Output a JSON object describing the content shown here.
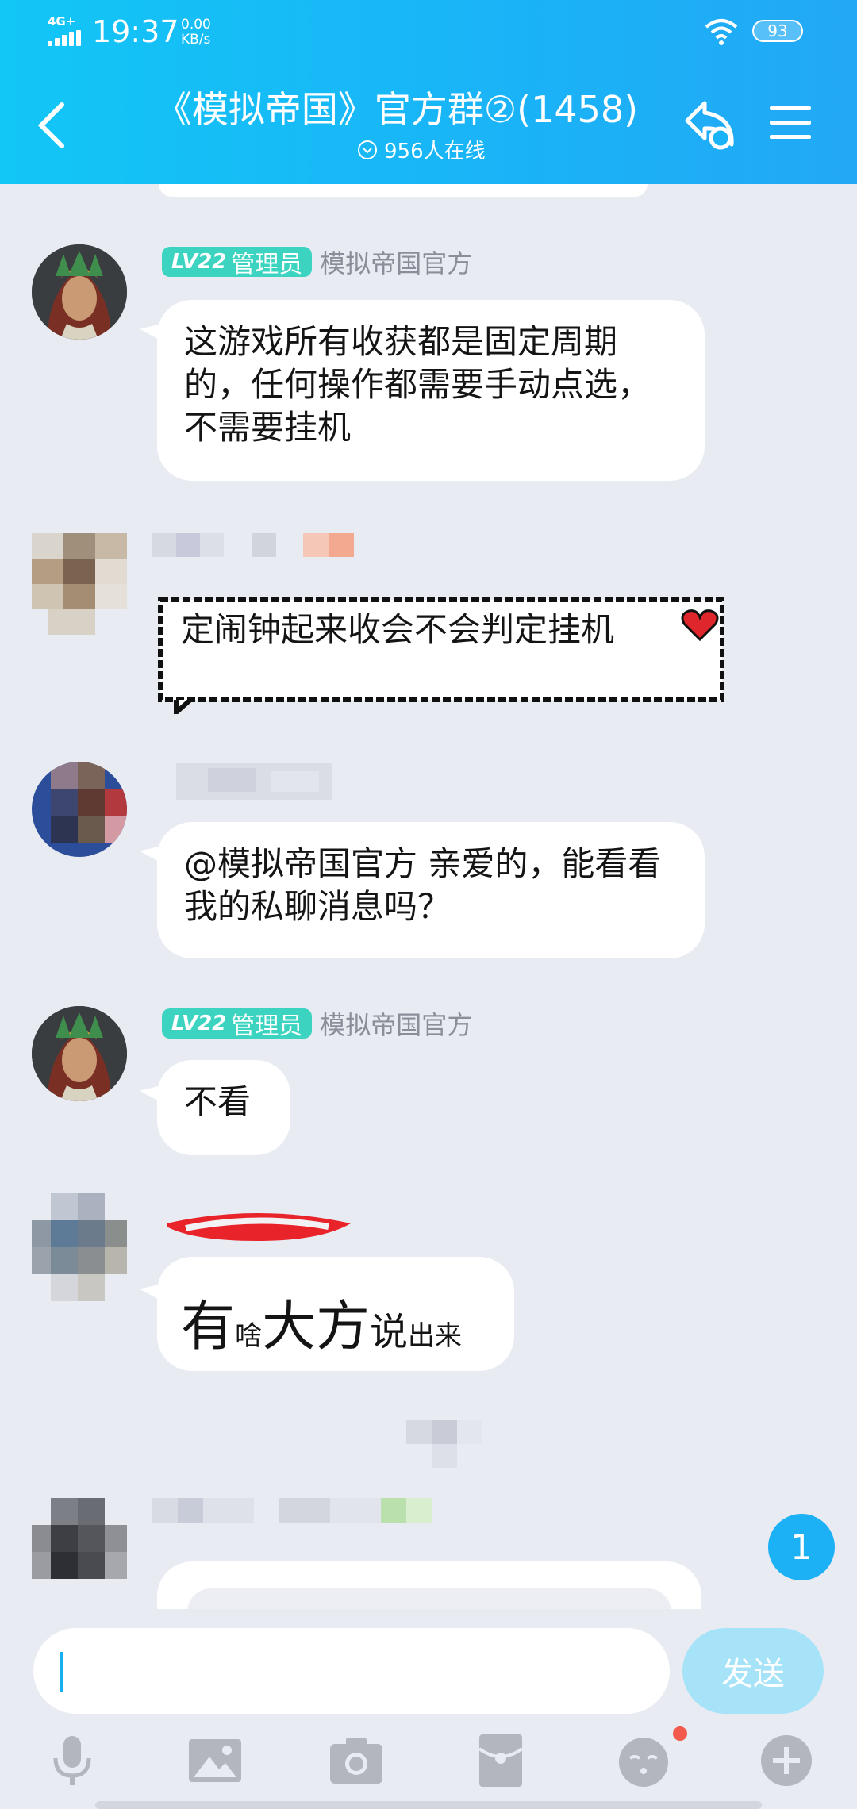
{
  "status_bar": {
    "network": "4G+",
    "time": "19:37",
    "speed_value": "0.00",
    "speed_unit": "KB/s",
    "battery": "93"
  },
  "header": {
    "title": "《模拟帝国》官方群②(1458)",
    "online": "956人在线"
  },
  "messages": [
    {
      "badge_level": "LV22",
      "badge_role": "管理员",
      "sender": "模拟帝国官方",
      "text": "这游戏所有收获都是固定周期的，任何操作都需要手动点选，不需要挂机"
    },
    {
      "text": "定闹钟起来收会不会判定挂机"
    },
    {
      "text": "@模拟帝国官方 亲爱的，能看看我的私聊消息吗？"
    },
    {
      "badge_level": "LV22",
      "badge_role": "管理员",
      "sender": "模拟帝国官方",
      "text": "不看"
    },
    {
      "parts": [
        "有",
        "啥",
        "大方",
        "说",
        "出来"
      ]
    }
  ],
  "unread_count": "1",
  "input": {
    "value": "",
    "send_label": "发送"
  },
  "toolbar": [
    "mic-icon",
    "image-icon",
    "camera-icon",
    "red-packet-icon",
    "emoji-icon",
    "plus-icon"
  ],
  "colors": {
    "header": "#1ab3f7",
    "badge": "#3cd4c0",
    "send_disabled": "#a6e3f8",
    "unread": "#1cb0f4"
  }
}
